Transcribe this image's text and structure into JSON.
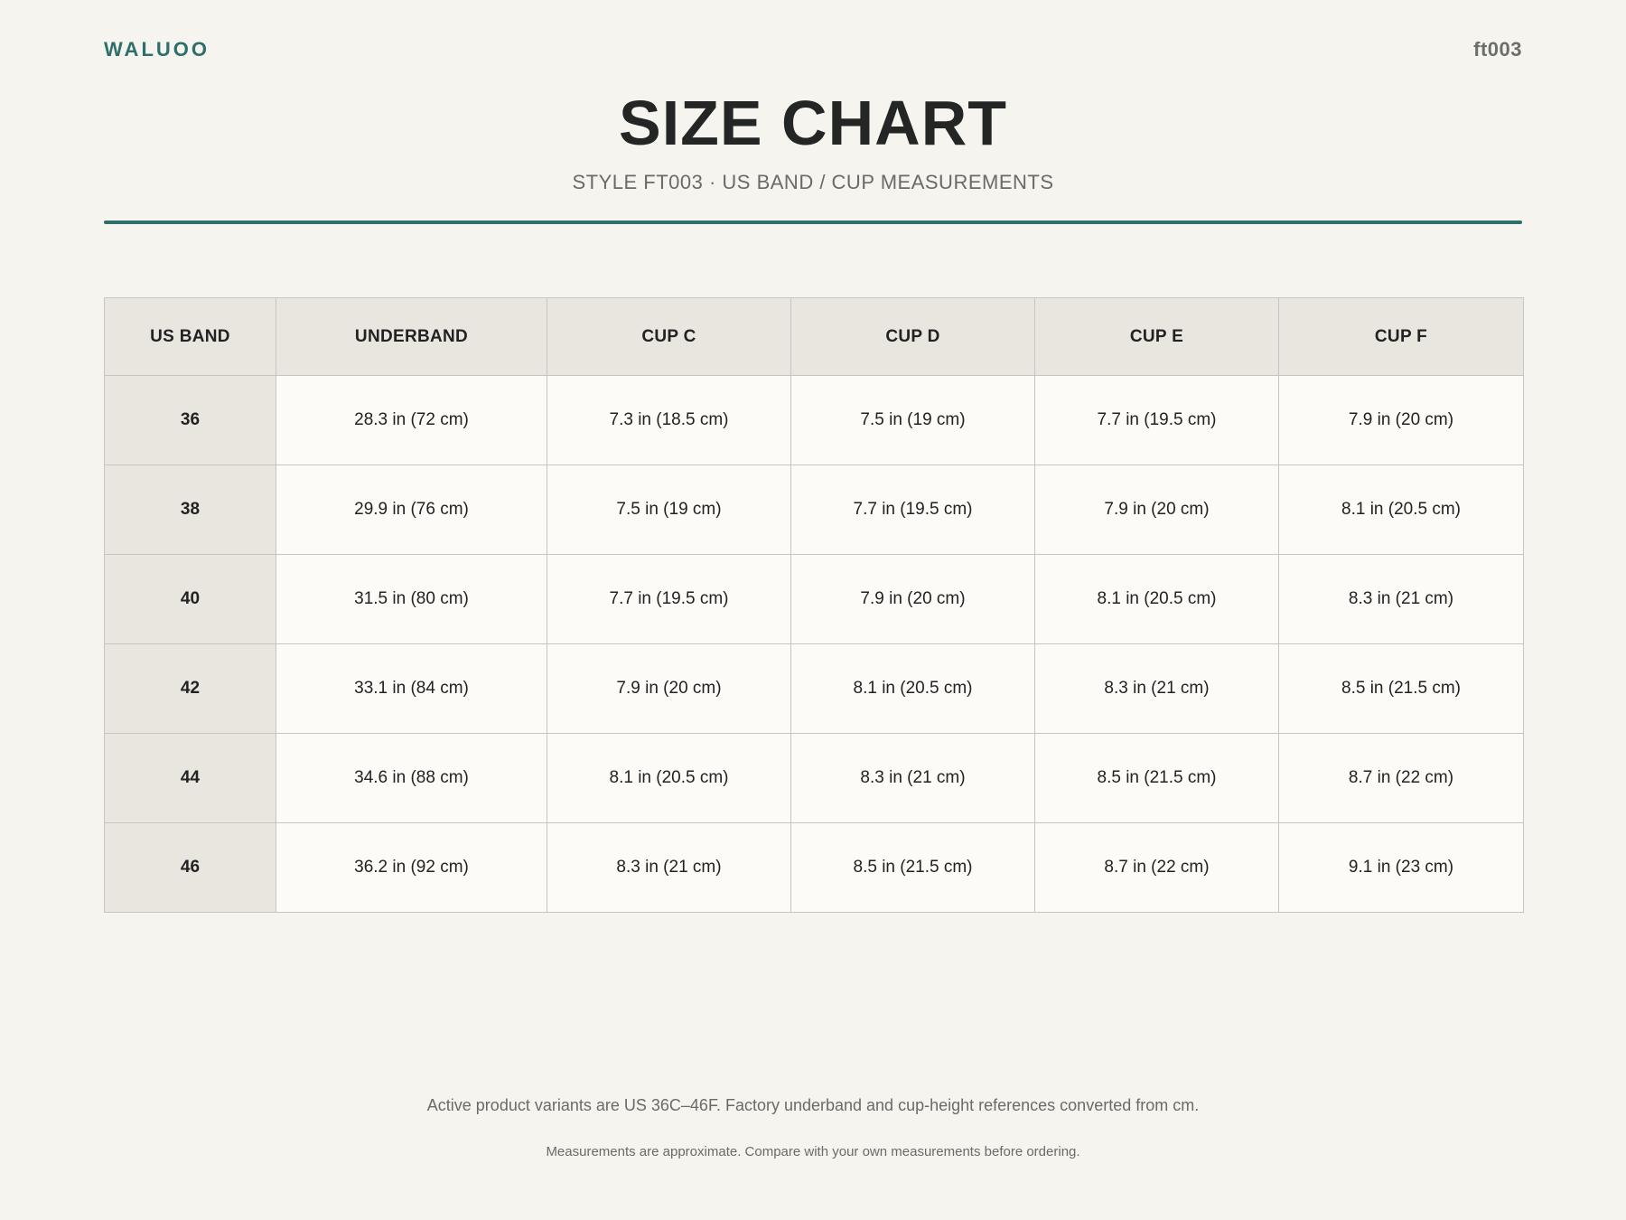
{
  "header": {
    "brand": "WALUOO",
    "style_code": "ft003",
    "title": "SIZE CHART",
    "subtitle": "STYLE FT003 · US BAND / CUP MEASUREMENTS"
  },
  "table": {
    "columns": [
      "US BAND",
      "UNDERBAND",
      "CUP C",
      "CUP D",
      "CUP E",
      "CUP F"
    ],
    "rows": [
      [
        "36",
        "28.3 in (72 cm)",
        "7.3 in (18.5 cm)",
        "7.5 in (19 cm)",
        "7.7 in (19.5 cm)",
        "7.9 in (20 cm)"
      ],
      [
        "38",
        "29.9 in (76 cm)",
        "7.5 in (19 cm)",
        "7.7 in (19.5 cm)",
        "7.9 in (20 cm)",
        "8.1 in (20.5 cm)"
      ],
      [
        "40",
        "31.5 in (80 cm)",
        "7.7 in (19.5 cm)",
        "7.9 in (20 cm)",
        "8.1 in (20.5 cm)",
        "8.3 in (21 cm)"
      ],
      [
        "42",
        "33.1 in (84 cm)",
        "7.9 in (20 cm)",
        "8.1 in (20.5 cm)",
        "8.3 in (21 cm)",
        "8.5 in (21.5 cm)"
      ],
      [
        "44",
        "34.6 in (88 cm)",
        "8.1 in (20.5 cm)",
        "8.3 in (21 cm)",
        "8.5 in (21.5 cm)",
        "8.7 in (22 cm)"
      ],
      [
        "46",
        "36.2 in (92 cm)",
        "8.3 in (21 cm)",
        "8.5 in (21.5 cm)",
        "8.7 in (22 cm)",
        "9.1 in (23 cm)"
      ]
    ]
  },
  "footer": {
    "note": "Active product variants are US 36C–46F. Factory underband and cup-height references converted from cm.",
    "disclaimer": "Measurements are approximate. Compare with your own measurements before ordering."
  },
  "colors": {
    "accent": "#2e6f6c",
    "background": "#f5f4ef",
    "header_cell": "#e8e6df",
    "body_cell": "#fcfbf7"
  }
}
